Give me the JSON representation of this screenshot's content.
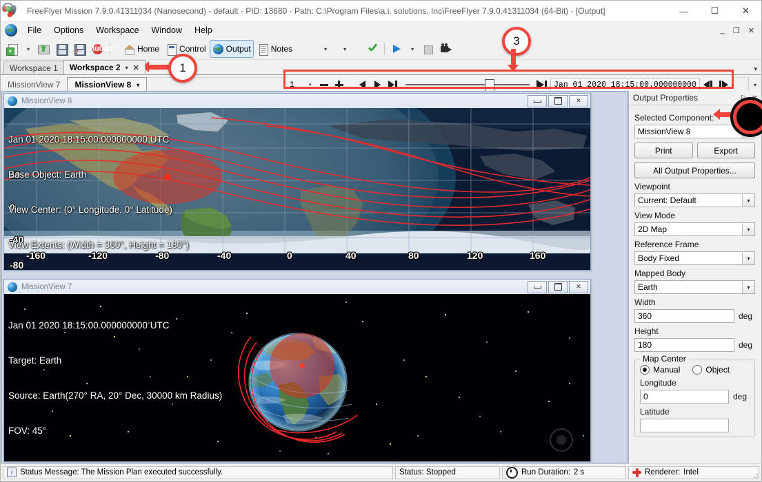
{
  "window": {
    "title": "FreeFlyer Mission 7.9.0.41311034 (Nanosecond) - default - PID: 13680 - Path: C:\\Program Files\\a.i. solutions, Inc\\FreeFlyer 7.9.0.41311034 (64-Bit) - [Output]",
    "minimize": "—",
    "maximize": "☐",
    "close": "✕"
  },
  "menu": {
    "items": [
      "File",
      "Options",
      "Workspace",
      "Window",
      "Help"
    ],
    "mdi_minimize": "_",
    "mdi_restore": "❐",
    "mdi_close": "✕"
  },
  "toolbar": {
    "new_label": "",
    "open_label": "",
    "save_label": "",
    "saveas_label": "",
    "close_label": "",
    "home_label": "Home",
    "control_label": "Control",
    "output_label": "Output",
    "notes_label": "Notes",
    "undo_label": "",
    "redo_label": "",
    "validate_label": "",
    "run_label": "",
    "stop_label": "",
    "record_label": "",
    "caret": "▾"
  },
  "workspace_tabs": {
    "items": [
      {
        "label": "Workspace 1",
        "active": false,
        "closable": false
      },
      {
        "label": "Workspace 2",
        "active": true,
        "closable": true
      }
    ],
    "close_glyph": "✕",
    "caret": "▾",
    "overflow": "▾"
  },
  "view_tabs": {
    "items": [
      {
        "label": "MissionView 7",
        "active": false
      },
      {
        "label": "MissionView 8",
        "active": true
      }
    ],
    "caret": "▾",
    "overflow_caret": "▾"
  },
  "animation": {
    "step_value": "1",
    "step_caret": "▾",
    "decrease": "minus-icon",
    "increase": "plus-icon",
    "step_back": "step-back-icon",
    "play_forward": "play-icon",
    "reset_to_start": "skip-start-icon",
    "jump_to_end": "skip-end-icon",
    "epoch": "Jan 01 2020 18:15:00.000000000",
    "nudge_back": "nudge-back-icon",
    "nudge_forward": "nudge-forward-icon",
    "slider_position_pct": 64
  },
  "missionview8": {
    "title": "MissionView 8",
    "minimize": "minimize-icon",
    "restore": "restore-icon",
    "close": "✕",
    "overlay": [
      "Jan 01 2020 18:15:00.000000000 UTC",
      "Base Object: Earth",
      "View Center: (0° Longitude, 0° Latitude)",
      "View Extents: (Width = 360°, Height = 180°)"
    ],
    "x_axis_labels": [
      "-160",
      "-120",
      "-80",
      "-40",
      "0",
      "40",
      "80",
      "120",
      "160"
    ],
    "y_axis_labels": [
      "40",
      "0",
      "-40",
      "-80"
    ]
  },
  "missionview7": {
    "title": "MissionView 7",
    "minimize": "minimize-icon",
    "restore": "restore-icon",
    "close": "✕",
    "overlay": [
      "Jan 01 2020 18:15:00.000000000 UTC",
      "Target: Earth",
      "Source: Earth(270° RA, 20° Dec, 30000 km Radius)",
      "FOV: 45°"
    ]
  },
  "properties": {
    "panel_title": "Output Properties",
    "pin_glyph": "⚐",
    "close_glyph": "✕",
    "selected_component_label": "Selected Component:",
    "selected_component_value": "MissionView 8",
    "print_label": "Print",
    "export_label": "Export",
    "all_output_label": "All Output Properties...",
    "viewpoint_label": "Viewpoint",
    "viewpoint_value": "Current: Default",
    "view_mode_label": "View Mode",
    "view_mode_value": "2D Map",
    "reference_frame_label": "Reference Frame",
    "reference_frame_value": "Body Fixed",
    "mapped_body_label": "Mapped Body",
    "mapped_body_value": "Earth",
    "width_label": "Width",
    "width_value": "360",
    "width_unit": "deg",
    "height_label": "Height",
    "height_value": "180",
    "height_unit": "deg",
    "map_center_label": "Map Center",
    "map_center_manual": "Manual",
    "map_center_object": "Object",
    "map_center_selected": "Manual",
    "longitude_label": "Longitude",
    "longitude_value": "0",
    "longitude_unit": "deg",
    "latitude_label": "Latitude",
    "dropdown_caret": "▾"
  },
  "status_bar": {
    "message": "Status Message: The Mission Plan executed successfully.",
    "status": "Status: Stopped",
    "run_duration_label": "Run Duration:",
    "run_duration_value": "2 s",
    "renderer_label": "Renderer:",
    "renderer_value": "Intel",
    "info_glyph": "i"
  },
  "annotations": [
    {
      "id": "1",
      "label": "1"
    },
    {
      "id": "3",
      "label": "3"
    }
  ],
  "colors": {
    "accent_red": "#f2453d",
    "window_bg": "#f0f0f0",
    "mdi_bg": "#cfd6e6",
    "title_bar": "#ffffff"
  }
}
